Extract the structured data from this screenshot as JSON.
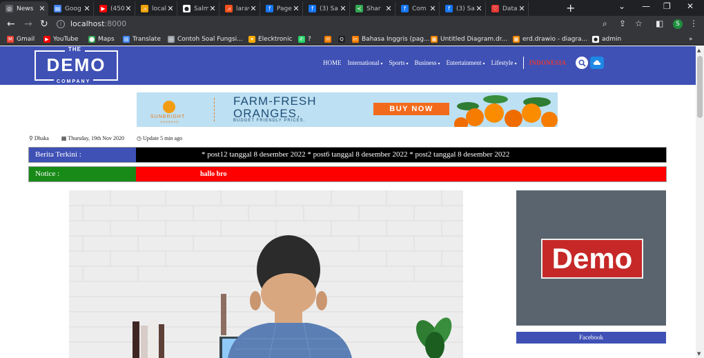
{
  "browser": {
    "tabs": [
      {
        "title": "News",
        "fav_color": "#5f6368",
        "fav_glyph": "◎",
        "active": true
      },
      {
        "title": "Goog",
        "fav_color": "#4285f4",
        "fav_glyph": "▤"
      },
      {
        "title": "(450)",
        "fav_color": "#ff0000",
        "fav_glyph": "▶"
      },
      {
        "title": "local",
        "fav_color": "#f0a30a",
        "fav_glyph": "⩘"
      },
      {
        "title": "Salm",
        "fav_color": "#ffffff",
        "fav_glyph": "●"
      },
      {
        "title": "larav",
        "fav_color": "#f4511e",
        "fav_glyph": "⩘"
      },
      {
        "title": "Page",
        "fav_color": "#1877f2",
        "fav_glyph": "f"
      },
      {
        "title": "(3) Sa",
        "fav_color": "#1877f2",
        "fav_glyph": "f"
      },
      {
        "title": "Shar",
        "fav_color": "#34a853",
        "fav_glyph": "≺"
      },
      {
        "title": "Com",
        "fav_color": "#1877f2",
        "fav_glyph": "f"
      },
      {
        "title": "(3) Sa",
        "fav_color": "#1877f2",
        "fav_glyph": "f"
      },
      {
        "title": "Data",
        "fav_color": "#e53935",
        "fav_glyph": "♡"
      }
    ],
    "url_host": "localhost",
    "url_port": ":8000",
    "profile_initial": "S",
    "bookmarks": [
      {
        "label": "Gmail",
        "color": "#ea4335",
        "glyph": "M"
      },
      {
        "label": "YouTube",
        "color": "#ff0000",
        "glyph": "▶"
      },
      {
        "label": "Maps",
        "color": "#34a853",
        "glyph": "⬤"
      },
      {
        "label": "Translate",
        "color": "#4285f4",
        "glyph": "▤"
      },
      {
        "label": "Contoh Soal Fungsi...",
        "color": "#9aa0a6",
        "glyph": "◎"
      },
      {
        "label": "Elecktronic",
        "color": "#f9ab00",
        "glyph": "✦"
      },
      {
        "label": "?",
        "color": "#25d366",
        "glyph": "✆"
      },
      {
        "label": "",
        "color": "#f57c00",
        "glyph": "✉"
      },
      {
        "label": "",
        "color": "#202124",
        "glyph": "Q"
      },
      {
        "label": "Bahasa Inggris (pag...",
        "color": "#f57c00",
        "glyph": "in"
      },
      {
        "label": "Untitled Diagram.dr...",
        "color": "#f08705",
        "glyph": "▦"
      },
      {
        "label": "erd.drawio - diagra...",
        "color": "#f08705",
        "glyph": "▦"
      },
      {
        "label": "admin",
        "color": "#ffffff",
        "glyph": "●"
      }
    ]
  },
  "site": {
    "logo": {
      "top": "THE",
      "main": "DEMO",
      "bottom": "COMPANY"
    },
    "nav": [
      {
        "label": "HOME",
        "dropdown": false
      },
      {
        "label": "International",
        "dropdown": true
      },
      {
        "label": "Sports",
        "dropdown": true
      },
      {
        "label": "Business",
        "dropdown": true
      },
      {
        "label": "Entertainment",
        "dropdown": true
      },
      {
        "label": "Lifestyle",
        "dropdown": true
      }
    ],
    "language": "INDONESIA",
    "banner": {
      "brand": "SUNBRIGHT",
      "brand_sub": "ORANGES",
      "headline_1": "FARM-FRESH",
      "headline_2": "ORANGES.",
      "subtext": "BUDGET FRIENDLY PRICES.",
      "cta": "BUY NOW"
    },
    "info": {
      "location": "Dhaka",
      "date": "Thursday, 19th Nov 2020",
      "update": "Update 5 min ago"
    },
    "ticker": {
      "label": "Berita Terkini :",
      "text": "* post12 tanggal 8 desember 2022 * post6 tanggal 8 desember 2022 * post2 tanggal 8 desember 2022"
    },
    "notice": {
      "label": "Notice :",
      "text": "hallo bro"
    },
    "sidebar": {
      "ad_text": "Demo",
      "facebook_label": "Facebook"
    }
  },
  "colors": {
    "header": "#3f51b5",
    "ticker_bg": "#000000",
    "notice_bg": "#ff0000",
    "notice_label": "#178a17"
  }
}
